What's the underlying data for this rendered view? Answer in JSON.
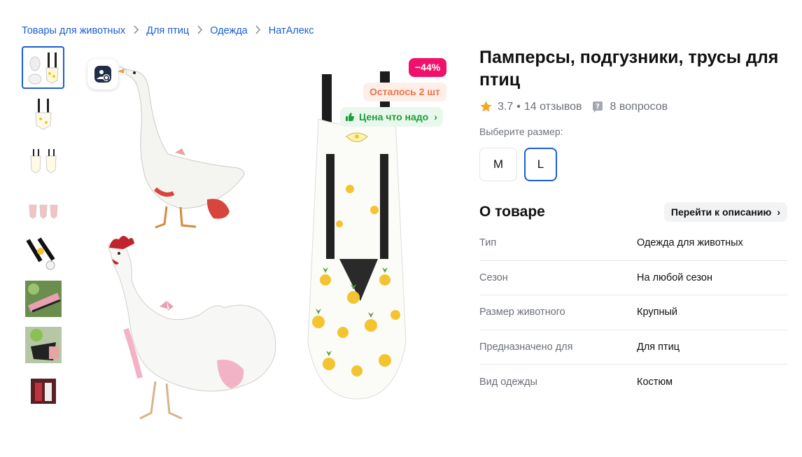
{
  "breadcrumbs": [
    "Товары для животных",
    "Для птиц",
    "Одежда",
    "НатАлекс"
  ],
  "gallery": {
    "badges": {
      "discount": "−44%",
      "stock_left": "Осталось 2 шт",
      "good_price": "Цена что надо"
    },
    "icons": {
      "lens": "image-search-icon",
      "like": "thumbs-up-icon"
    }
  },
  "product": {
    "title": "Памперсы, подгузники, трусы для птиц",
    "rating": "3.7",
    "rating_separator": "•",
    "reviews": "14 отзывов",
    "questions": "8 вопросов",
    "size_label": "Выберите размер:",
    "sizes": [
      "M",
      "L"
    ],
    "selected_size": "L"
  },
  "about": {
    "title": "О товаре",
    "goto_description": "Перейти к описанию",
    "specs": [
      {
        "name": "Тип",
        "value": "Одежда для животных"
      },
      {
        "name": "Сезон",
        "value": "На любой сезон"
      },
      {
        "name": "Размер животного",
        "value": "Крупный"
      },
      {
        "name": "Предназначено для",
        "value": "Для птиц"
      },
      {
        "name": "Вид одежды",
        "value": "Костюм"
      }
    ]
  },
  "colors": {
    "link": "#1a5fd1",
    "discount_bg": "#f1116a",
    "stock_text": "#f0724a",
    "good_price_text": "#1c9e3c",
    "star": "#f5a623"
  }
}
